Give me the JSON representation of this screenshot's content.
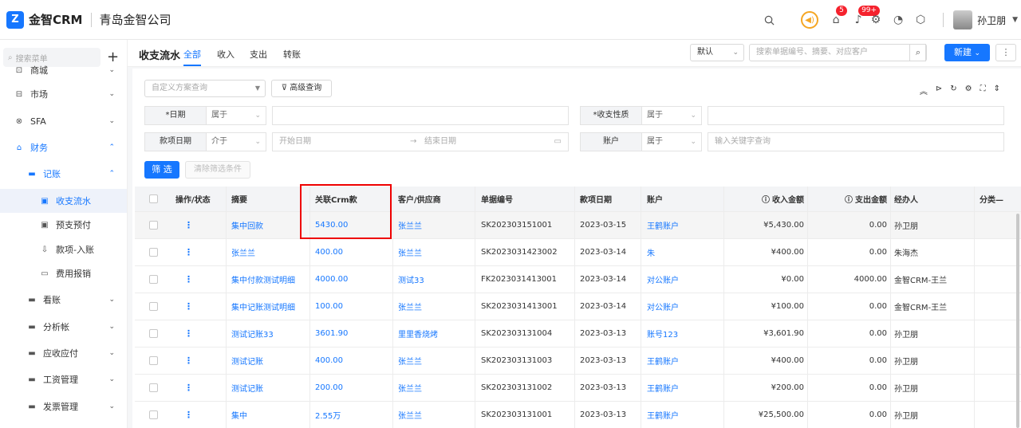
{
  "topbar": {
    "logo_glyph": "Z",
    "brand": "金智CRM",
    "company": "青岛金智公司",
    "mail_badge": "5",
    "notif_badge": "99+",
    "username": "孙卫朋"
  },
  "sidebar": {
    "search_placeholder": "搜索菜单",
    "items": [
      {
        "label": "商城",
        "icon": "store-icon"
      },
      {
        "label": "市场",
        "icon": "market-icon"
      },
      {
        "label": "SFA",
        "icon": "sfa-icon"
      },
      {
        "label": "财务",
        "icon": "finance-icon"
      },
      {
        "label": "记账",
        "icon": "folder-icon"
      },
      {
        "label": "收支流水",
        "icon": "doc-icon"
      },
      {
        "label": "预支预付",
        "icon": "doc-icon"
      },
      {
        "label": "款项-入账",
        "icon": "doc-icon"
      },
      {
        "label": "费用报销",
        "icon": "doc-icon"
      },
      {
        "label": "看账",
        "icon": "folder-icon"
      },
      {
        "label": "分析帐",
        "icon": "folder-icon"
      },
      {
        "label": "应收应付",
        "icon": "folder-icon"
      },
      {
        "label": "工资管理",
        "icon": "folder-icon"
      },
      {
        "label": "发票管理",
        "icon": "folder-icon"
      }
    ]
  },
  "header": {
    "title": "收支流水",
    "tabs": [
      "全部",
      "收入",
      "支出",
      "转账"
    ],
    "view_select": "默认",
    "search_placeholder": "搜索单据编号、摘要、对应客户",
    "new_button": "新建",
    "more_button": "⋮"
  },
  "filters": {
    "scheme_placeholder": "自定义方案查询",
    "advanced_button": "高级查询",
    "date_label": "*日期",
    "date_op": "属于",
    "nature_label": "*收支性质",
    "nature_op": "属于",
    "due_label": "款项日期",
    "due_op": "介于",
    "start_placeholder": "开始日期",
    "end_placeholder": "结束日期",
    "account_label": "账户",
    "account_op": "属于",
    "keyword_placeholder": "输入关键字查询",
    "filter_button": "筛 选",
    "clear_button": "清除筛选条件"
  },
  "table": {
    "headers": [
      "操作/状态",
      "摘要",
      "关联Crm款",
      "客户/供应商",
      "单据编号",
      "款项日期",
      "账户",
      "收入金额",
      "支出金额",
      "经办人",
      "分类—"
    ],
    "rows": [
      {
        "summary": "集中回款",
        "crm": "5430.00",
        "customer": "张兰兰",
        "doc": "SK202303151001",
        "date": "2023-03-15",
        "account": "王鹤账户",
        "income": "¥5,430.00",
        "expense": "0.00",
        "handler": "孙卫朋"
      },
      {
        "summary": "张兰兰",
        "crm": "400.00",
        "customer": "张兰兰",
        "doc": "SK2023031423002",
        "date": "2023-03-14",
        "account": "朱",
        "income": "¥400.00",
        "expense": "0.00",
        "handler": "朱海杰"
      },
      {
        "summary": "集中付款测试明细",
        "crm": "4000.00",
        "customer": "测试33",
        "doc": "FK2023031413001",
        "date": "2023-03-14",
        "account": "对公账户",
        "income": "¥0.00",
        "expense": "4000.00",
        "handler": "金智CRM-王兰"
      },
      {
        "summary": "集中记账测试明细",
        "crm": "100.00",
        "customer": "张兰兰",
        "doc": "SK2023031413001",
        "date": "2023-03-14",
        "account": "对公账户",
        "income": "¥100.00",
        "expense": "0.00",
        "handler": "金智CRM-王兰"
      },
      {
        "summary": "测试记账33",
        "crm": "3601.90",
        "customer": "里里香烧烤",
        "doc": "SK2023031310​04",
        "date": "2023-03-13",
        "account": "账号123",
        "income": "¥3,601.90",
        "expense": "0.00",
        "handler": "孙卫朋"
      },
      {
        "summary": "测试记账",
        "crm": "400.00",
        "customer": "张兰兰",
        "doc": "SK202303131003",
        "date": "2023-03-13",
        "account": "王鹤账户",
        "income": "¥400.00",
        "expense": "0.00",
        "handler": "孙卫朋"
      },
      {
        "summary": "测试记账",
        "crm": "200.00",
        "customer": "张兰兰",
        "doc": "SK202303131002",
        "date": "2023-03-13",
        "account": "王鹤账户",
        "income": "¥200.00",
        "expense": "0.00",
        "handler": "孙卫朋"
      },
      {
        "summary": "集中",
        "crm": "2.55万",
        "customer": "张兰兰",
        "doc": "SK202303131001",
        "date": "2023-03-13",
        "account": "王鹤账户",
        "income": "¥25,500.00",
        "expense": "0.00",
        "handler": "孙卫朋"
      }
    ]
  },
  "colors": {
    "accent": "#1677ff",
    "highlight_box": "#ee0000"
  }
}
